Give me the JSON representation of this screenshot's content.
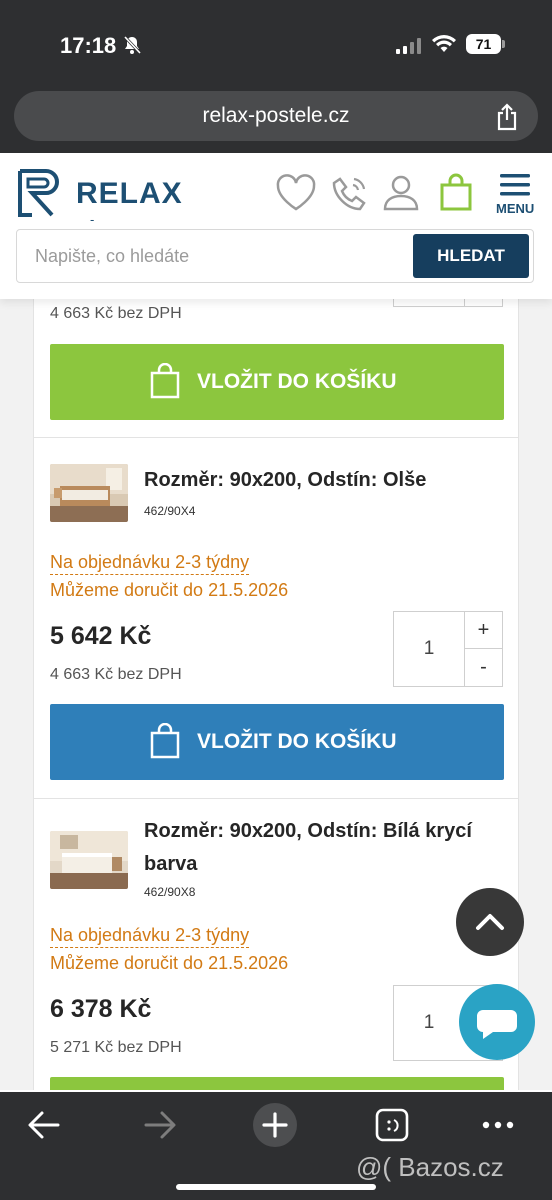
{
  "status_bar": {
    "time": "17:18",
    "battery": "71"
  },
  "browser": {
    "url": "relax-postele.cz"
  },
  "header": {
    "logo_main": "RELAX",
    "logo_sub": "- POSTELE -",
    "menu_label": "MENU",
    "search_placeholder": "Napište, co hledáte",
    "search_button": "HLEDAT",
    "icons": [
      "heart-icon",
      "phone-icon",
      "user-icon",
      "cart-icon",
      "menu-icon"
    ]
  },
  "items": [
    {
      "net_price": "4 663 Kč bez DPH",
      "qty_minus": "-",
      "cart_label": "VLOŽIT DO KOŠÍKU"
    },
    {
      "title": "Rozměr: 90x200, Odstín: Olše",
      "code": "462/90X4",
      "availability": "Na objednávku 2-3 týdny",
      "delivery": "Můžeme doručit do  21.5.2026",
      "price": "5 642 Kč",
      "net_price": "4 663 Kč bez DPH",
      "qty": "1",
      "qty_plus": "+",
      "qty_minus": "-",
      "cart_label": "VLOŽIT DO KOŠÍKU"
    },
    {
      "title": "Rozměr: 90x200, Odstín: Bílá krycí barva",
      "code": "462/90X8",
      "availability": "Na objednávku 2-3 týdny",
      "delivery": "Můžeme doručit do  21.5.2026",
      "price": "6 378 Kč",
      "net_price": "5 271 Kč bez DPH",
      "qty": "1"
    }
  ],
  "colors": {
    "brand_blue": "#1d4f73",
    "green_button": "#8cc63e",
    "blue_button": "#2f7fb9",
    "orange_text": "#d27a14"
  },
  "watermark": "@( Bazos.cz"
}
